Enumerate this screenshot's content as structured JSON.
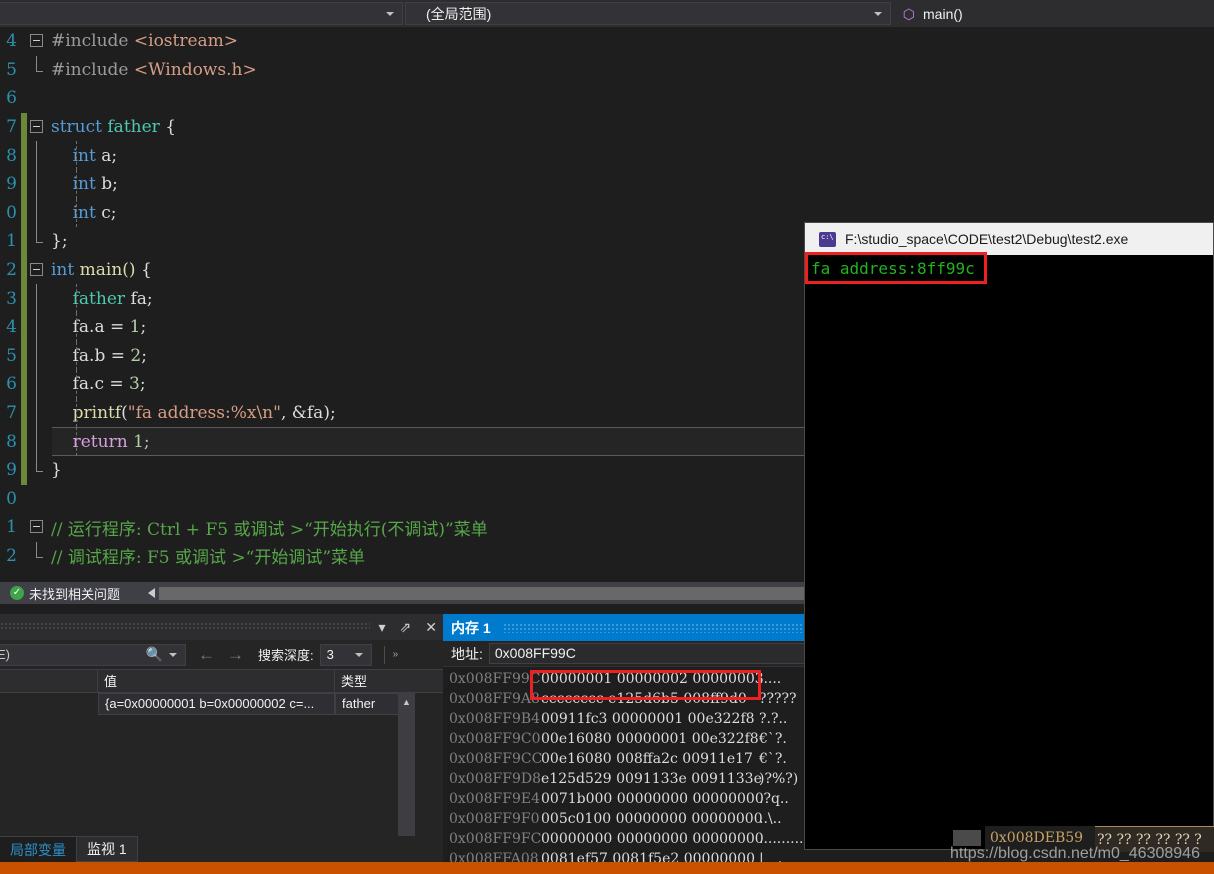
{
  "navbar": {
    "scope_left": "",
    "scope_mid": "(全局范围)",
    "function": "main()",
    "cube_icon": "cube-icon",
    "arrow_icon": "chevron-down-icon"
  },
  "editor": {
    "lines": [
      {
        "num": "4",
        "indent": 0,
        "text": "#include <iostream>"
      },
      {
        "num": "5",
        "indent": 0,
        "text": "#include <Windows.h>"
      },
      {
        "num": "6",
        "indent": 0,
        "text": ""
      },
      {
        "num": "7",
        "indent": 0,
        "text": "struct father {"
      },
      {
        "num": "8",
        "indent": 1,
        "text": "int a;"
      },
      {
        "num": "9",
        "indent": 1,
        "text": "int b;"
      },
      {
        "num": "0",
        "indent": 1,
        "text": "int c;"
      },
      {
        "num": "1",
        "indent": 0,
        "text": "};"
      },
      {
        "num": "2",
        "indent": 0,
        "text": "int main() {"
      },
      {
        "num": "3",
        "indent": 1,
        "text": "father fa;"
      },
      {
        "num": "4",
        "indent": 1,
        "text": "fa.a = 1;"
      },
      {
        "num": "5",
        "indent": 1,
        "text": "fa.b = 2;"
      },
      {
        "num": "6",
        "indent": 1,
        "text": "fa.c = 3;"
      },
      {
        "num": "7",
        "indent": 1,
        "text": "printf(\"fa address:%x\\n\", &fa);"
      },
      {
        "num": "8",
        "indent": 1,
        "text": "return 1;"
      },
      {
        "num": "9",
        "indent": 0,
        "text": "}"
      },
      {
        "num": "0",
        "indent": 0,
        "text": ""
      },
      {
        "num": "1",
        "indent": 0,
        "text": "// 运行程序: Ctrl + F5 或调试 >“开始执行(不调试)”菜单"
      },
      {
        "num": "2",
        "indent": 0,
        "text": "// 调试程序: F5 或调试 >“开始调试”菜单"
      }
    ],
    "tok": {
      "inc_iostream_pre": "#include ",
      "inc_iostream_hdr": "<iostream>",
      "inc_windows_pre": "#include ",
      "inc_windows_hdr": "<Windows.h>",
      "kw_struct": "struct",
      "type_father": "father",
      "brace_open": "{",
      "kw_int": "int",
      "var_a": "a;",
      "var_b": "b;",
      "var_c": "c;",
      "brace_close_semi": "};",
      "fn_main": "main()",
      "decl_father": "father",
      "decl_fa": "fa;",
      "stmt_faa": "fa.a = ",
      "num1": "1",
      "semi": ";",
      "stmt_fab": "fa.b = ",
      "num2": "2",
      "stmt_fac": "fa.c = ",
      "num3": "3",
      "printf_fn": "printf",
      "printf_open": "(",
      "printf_str": "\"fa address:%x\\n\"",
      "printf_arg": ", &fa);",
      "kw_return": "return",
      "ret_val": " 1;",
      "brace_close": "}",
      "comment_run": "// 运行程序: Ctrl + F5 或调试 >“开始执行(不调试)”菜单",
      "comment_debug": "// 调试程序: F5 或调试 >“开始调试”菜单"
    }
  },
  "problem_strip": {
    "status_text": "未找到相关问题",
    "check_icon": "check-circle-icon",
    "glyph": "✓"
  },
  "locals_panel": {
    "titlebar": {
      "dropdown_glyph": "▾",
      "pin_glyph": "⇗",
      "close_glyph": "✕"
    },
    "search_value": "E)",
    "search_icon": "search-icon",
    "search_glyph": "🔍",
    "nav_back_glyph": "←",
    "nav_forward_glyph": "→",
    "depth_label": "搜索深度:",
    "depth_value": "3",
    "headers": {
      "name": "",
      "value": "值",
      "type": "类型"
    },
    "rows": [
      {
        "name": "",
        "value": "{a=0x00000001 b=0x00000002 c=...",
        "type": "father"
      }
    ]
  },
  "memory_panel": {
    "tab_title": "内存 1",
    "address_label": "地址:",
    "address_value": "0x008FF99C",
    "rows": [
      {
        "addr": "0x008FF99C",
        "hex": "00000001 00000002 00000003",
        "ascii": "....."
      },
      {
        "addr": "0x008FF9A8",
        "hex": "cccccccc e125d6b5 008ff9d0",
        "ascii": "?????"
      },
      {
        "addr": "0x008FF9B4",
        "hex": "00911fc3 00000001 00e322f8",
        "ascii": "?.?.."
      },
      {
        "addr": "0x008FF9C0",
        "hex": "00e16080 00000001 00e322f8",
        "ascii": "€`?."
      },
      {
        "addr": "0x008FF9CC",
        "hex": "00e16080 008ffa2c 00911e17",
        "ascii": "€`?."
      },
      {
        "addr": "0x008FF9D8",
        "hex": "e125d529 0091133e 0091133e",
        "ascii": ")?%?)"
      },
      {
        "addr": "0x008FF9E4",
        "hex": "0071b000 00000000 00000000",
        "ascii": ".?q.."
      },
      {
        "addr": "0x008FF9F0",
        "hex": "005c0100 00000000 00000000",
        "ascii": "..\\.."
      },
      {
        "addr": "0x008FF9FC",
        "hex": "00000000 00000000 00000000",
        "ascii": "............"
      },
      {
        "addr": "0x008FFA08",
        "hex": "0081ef57 0081f5e2 00000000",
        "ascii": "|__.___"
      }
    ]
  },
  "console": {
    "title": "F:\\studio_space\\CODE\\test2\\Debug\\test2.exe",
    "icon": "cmd-prompt-icon",
    "output_line": "fa address:8ff99c"
  },
  "byte_window": {
    "address": "0x008DEB59",
    "bytes": "?? ?? ?? ?? ?? ?"
  },
  "watermark": {
    "text": "https://blog.csdn.net/m0_46308946"
  },
  "bottom_tabs": {
    "tabs": [
      {
        "label": "局部变量",
        "active": true
      },
      {
        "label": "监视 1",
        "active": false
      }
    ]
  },
  "colors": {
    "editor_bg": "#1e1e1e",
    "chrome_bg": "#2d2d30",
    "accent_blue": "#007acc",
    "status_orange": "#ca5100",
    "highlight_red": "#f02020",
    "save_green": "#6a8a3a",
    "console_green": "#22b222"
  }
}
